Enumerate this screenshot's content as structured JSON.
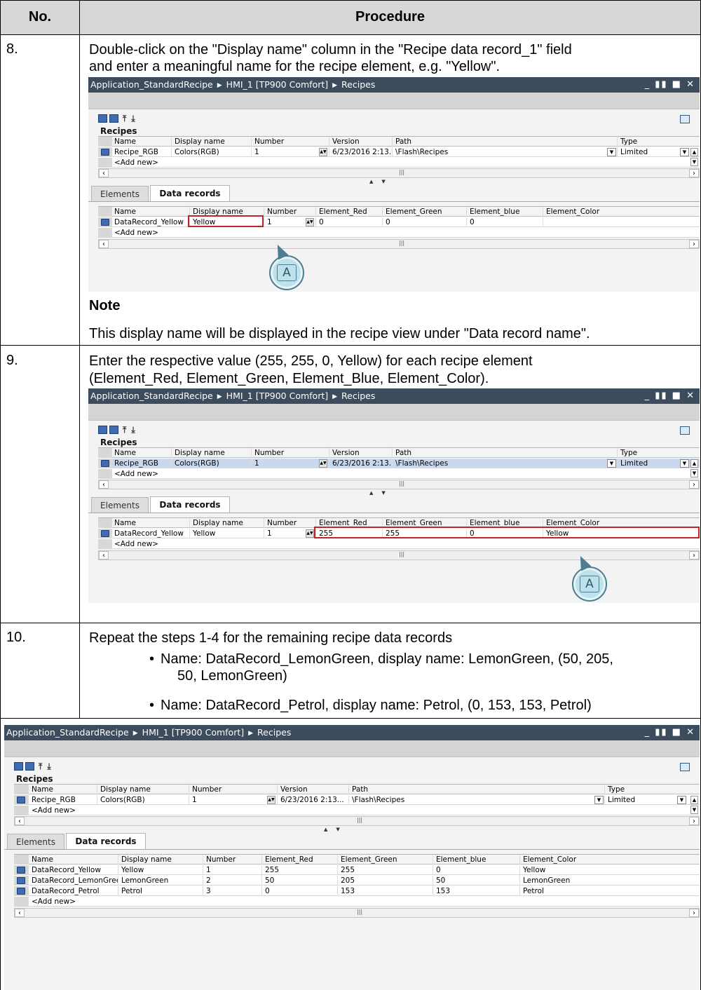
{
  "table": {
    "col_no": "No.",
    "col_procedure": "Procedure"
  },
  "step8": {
    "no": "8.",
    "text_line1": "Double-click on the \"Display name\" column in the \"Recipe data record_1\" field",
    "text_line2": "and enter a meaningful name for the recipe element, e.g. \"Yellow\".",
    "note_title": "Note",
    "note_text": "This display name will be displayed in the recipe view under \"Data record name\"."
  },
  "step9": {
    "no": "9.",
    "text_line1": "Enter the respective value (255, 255, 0, Yellow) for each recipe element",
    "text_line2": "(Element_Red, Element_Green, Element_Blue, Element_Color)."
  },
  "step10": {
    "no": "10.",
    "text": "Repeat the steps 1-4 for the remaining recipe data records",
    "bullet1_line1": "Name: DataRecord_LemonGreen, display name: LemonGreen, (50, 205,",
    "bullet1_line2": "50, LemonGreen)",
    "bullet2": "Name: DataRecord_Petrol, display name: Petrol, (0, 153, 153, Petrol)"
  },
  "window": {
    "crumb1": "Application_StandardRecipe",
    "crumb2": "HMI_1 [TP900 Comfort]",
    "crumb3": "Recipes",
    "controls": "_ ▮▮ ■ ✕",
    "recipes_title": "Recipes",
    "recipes_headers": [
      "Name",
      "Display name",
      "Number",
      "Version",
      "Path",
      "Type"
    ],
    "recipe_row": [
      "Recipe_RGB",
      "Colors(RGB)",
      "1",
      "6/23/2016 2:13...",
      "\\Flash\\Recipes",
      "Limited"
    ],
    "add_new": "<Add new>",
    "tab_elements": "Elements",
    "tab_records": "Data records",
    "records_headers": [
      "Name",
      "Display name",
      "Number",
      "Element_Red",
      "Element_Green",
      "Element_blue",
      "Element_Color"
    ],
    "cursor_label": "A"
  },
  "shot1_record": [
    "DataRecord_Yellow",
    "Yellow",
    "1",
    "0",
    "0",
    "0",
    ""
  ],
  "shot2_record": [
    "DataRecord_Yellow",
    "Yellow",
    "1",
    "255",
    "255",
    "0",
    "Yellow"
  ],
  "shot3_records": [
    [
      "DataRecord_Yellow",
      "Yellow",
      "1",
      "255",
      "255",
      "0",
      "Yellow"
    ],
    [
      "DataRecord_LemonGreen",
      "LemonGreen",
      "2",
      "50",
      "205",
      "50",
      "LemonGreen"
    ],
    [
      "DataRecord_Petrol",
      "Petrol",
      "3",
      "0",
      "153",
      "153",
      "Petrol"
    ]
  ],
  "colors": {
    "title_bar": "#3c4c5c",
    "header_bg": "#d7d7d7",
    "highlight": "#c0242b",
    "selected_row": "#c9d8ec",
    "recipe_icon": "#3f6cb0"
  }
}
